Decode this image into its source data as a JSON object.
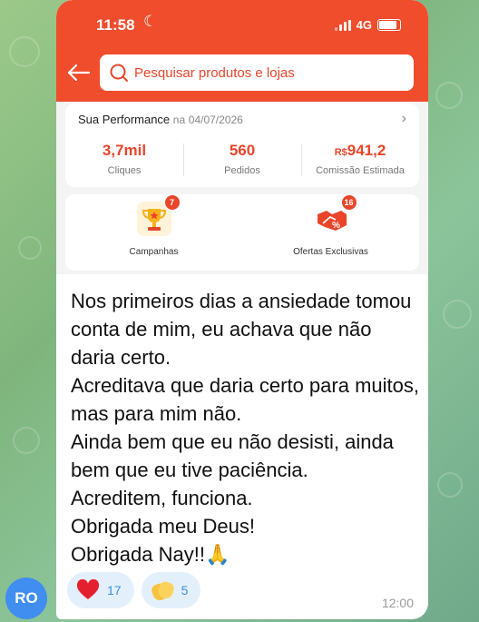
{
  "status_bar": {
    "time": "11:58",
    "network": "4G"
  },
  "search": {
    "placeholder": "Pesquisar produtos e lojas"
  },
  "performance": {
    "title": "Sua Performance",
    "date_prefix": "na",
    "date": "04/07/2026",
    "metrics": [
      {
        "value": "3,7mil",
        "label": "Cliques"
      },
      {
        "value": "560",
        "label": "Pedidos"
      },
      {
        "currency": "R$",
        "value": "941,2",
        "label": "Comissão Estimada"
      }
    ]
  },
  "promos": [
    {
      "label": "Campanhas",
      "badge": "7",
      "icon": "trophy-icon"
    },
    {
      "label": "Ofertas Exclusivas",
      "badge": "16",
      "icon": "handshake-discount-icon"
    }
  ],
  "message": {
    "lines": [
      "Nos primeiros dias a ansiedade tomou conta de mim, eu achava que não daria certo.",
      "Acreditava que daria certo para muitos, mas para mim não.",
      "Ainda bem que eu não desisti, ainda bem que eu tive paciência.",
      "Acreditem, funciona.",
      "Obrigada meu Deus!",
      "Obrigada Nay!!🙏"
    ],
    "time": "12:00"
  },
  "reactions": [
    {
      "emoji": "❤️",
      "count": "17",
      "icon": "heart-icon"
    },
    {
      "emoji": "👏",
      "count": "5",
      "icon": "clapping-hands-icon"
    }
  ],
  "sender": {
    "initials": "RO"
  },
  "colors": {
    "shopee_orange": "#f04d2d",
    "telegram_blue": "#3f8ef0"
  }
}
